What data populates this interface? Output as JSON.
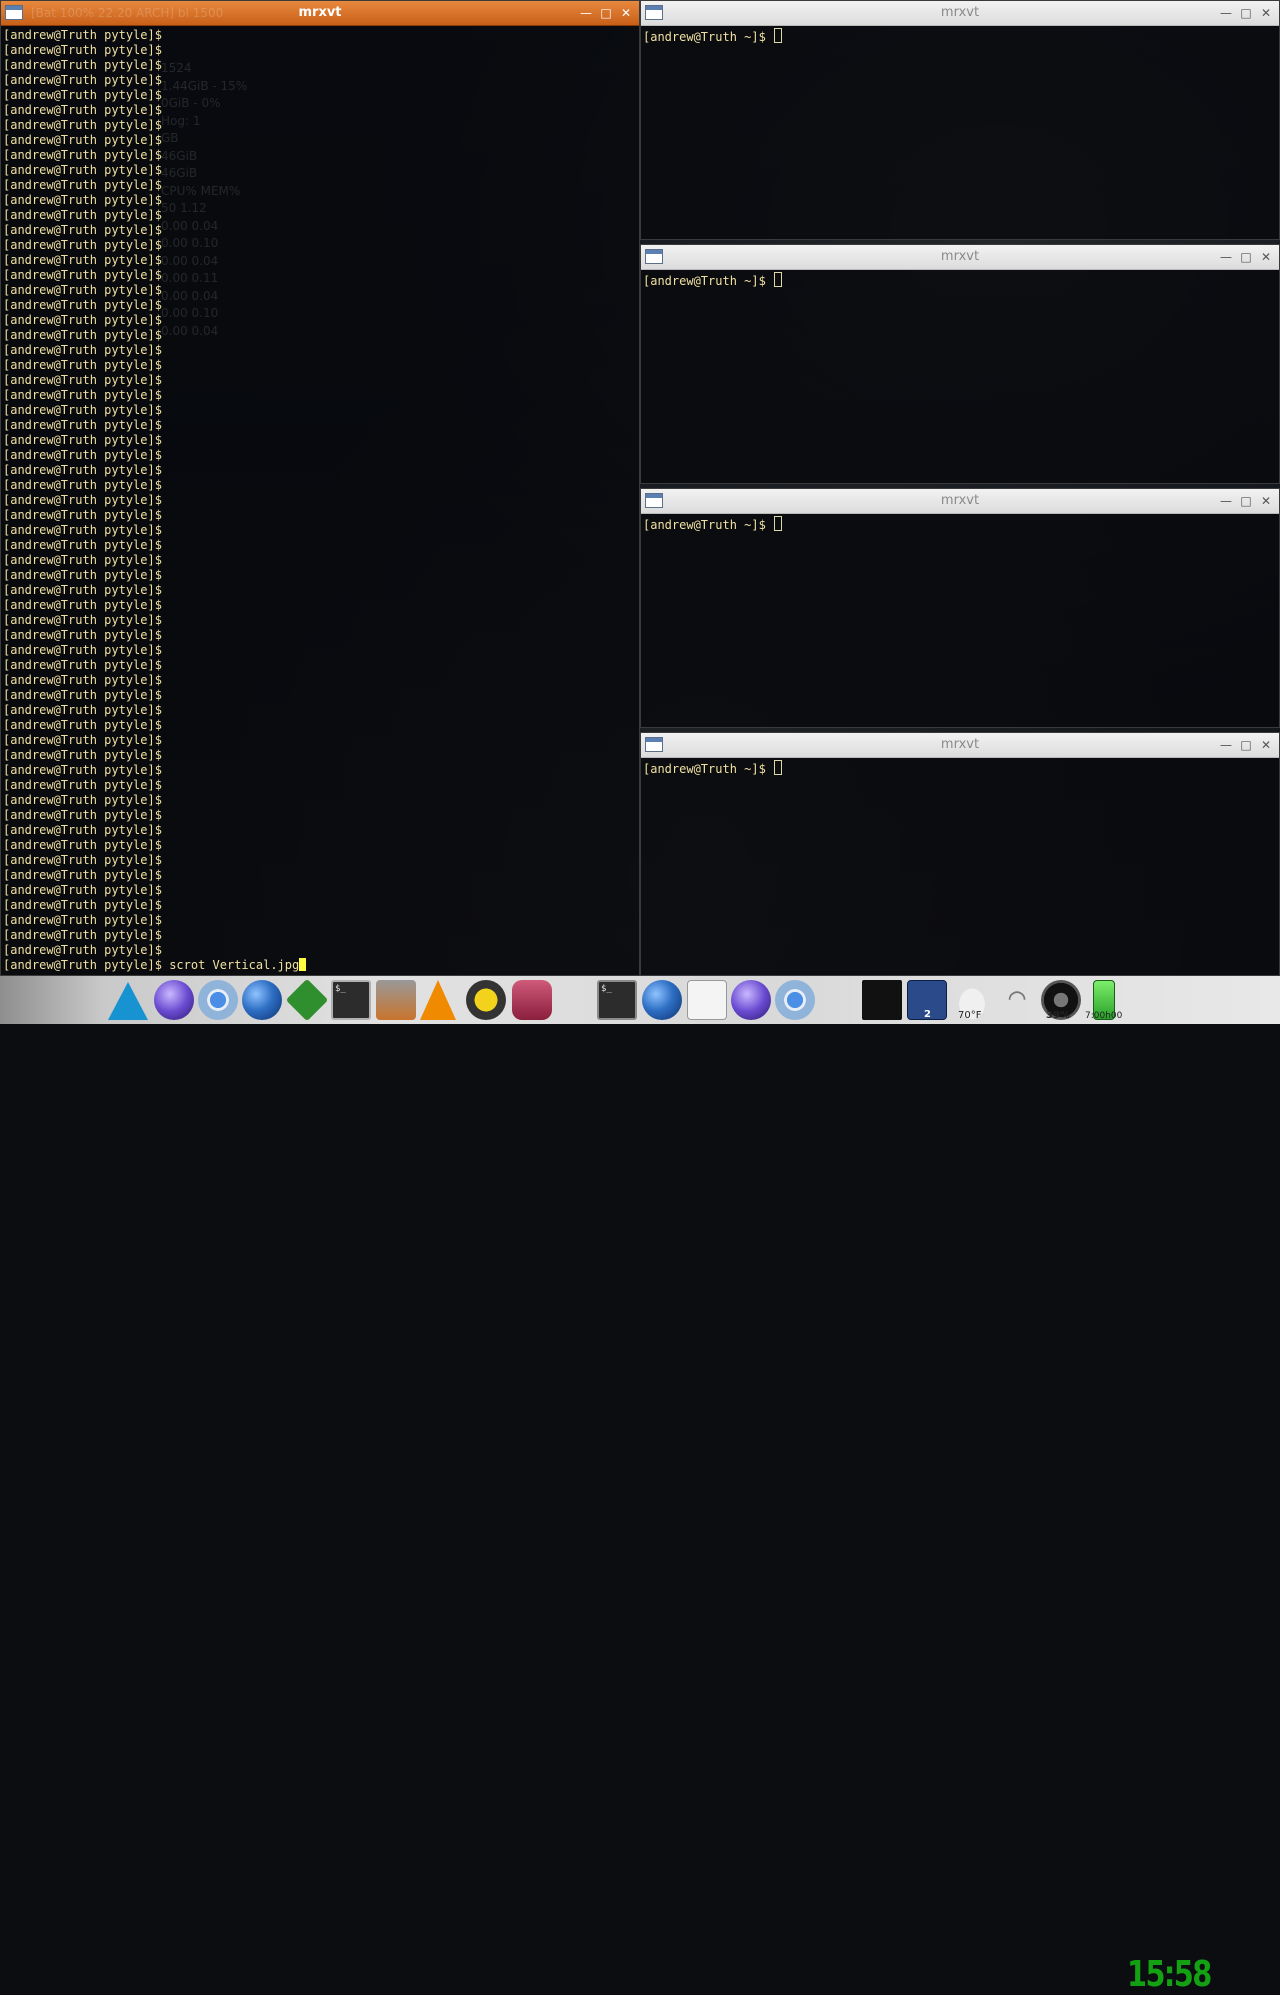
{
  "windows": [
    {
      "id": "main",
      "title": "mrxvt",
      "active": true,
      "ghost_title": "[Bat 100% 22.20 ARCH] bl 1500",
      "buttons": {
        "minimize": "—",
        "maximize": "□",
        "close": "✕"
      },
      "prompt": "[andrew@Truth pytyle]$",
      "prompt_repeat": 62,
      "last_command": "scrot Vertical.jpg"
    },
    {
      "id": "t1",
      "title": "mrxvt",
      "active": false,
      "prompt": "[andrew@Truth ~]$",
      "buttons": {
        "minimize": "—",
        "maximize": "□",
        "close": "✕"
      }
    },
    {
      "id": "t2",
      "title": "mrxvt",
      "active": false,
      "prompt": "[andrew@Truth ~]$",
      "buttons": {
        "minimize": "—",
        "maximize": "□",
        "close": "✕"
      }
    },
    {
      "id": "t3",
      "title": "mrxvt",
      "active": false,
      "prompt": "[andrew@Truth ~]$",
      "buttons": {
        "minimize": "—",
        "maximize": "□",
        "close": "✕"
      }
    },
    {
      "id": "t4",
      "title": "mrxvt",
      "active": false,
      "prompt": "[andrew@Truth ~]$",
      "buttons": {
        "minimize": "—",
        "maximize": "□",
        "close": "✕"
      }
    }
  ],
  "conky_ghost": [
    "1524",
    "1.44GiB - 15%",
    "0GiB - 0%",
    "Hog: 1",
    "GB",
    "46GiB",
    "46GiB",
    "CPU%   MEM%",
    "50   1.12",
    "0.00   0.04",
    "0.00   0.10",
    "0.00   0.04",
    "0.00   0.11",
    "0.00   0.04",
    "0.00   0.10",
    "0.00   0.04"
  ],
  "taskbar": {
    "launchers": [
      "arch-linux-icon",
      "orb-browser-icon",
      "chromium-icon",
      "firefox-globe-icon",
      "vim-icon",
      "terminal-icon",
      "tools-icon",
      "vlc-icon",
      "game-icon",
      "database-icon"
    ],
    "tasks": [
      "terminal-task-icon",
      "globe-task-icon",
      "document-task-icon",
      "orb-task-icon",
      "chromium-task-icon"
    ],
    "tray": {
      "weather_temp": "70°F",
      "workspace_number": "2",
      "volume_percent": "39%",
      "battery_time": "7:00h00",
      "clock": "15:58"
    }
  },
  "colors": {
    "active_titlebar": "#d06a22",
    "prompt_text": "#f0e0a0",
    "clock": "#13a013"
  }
}
